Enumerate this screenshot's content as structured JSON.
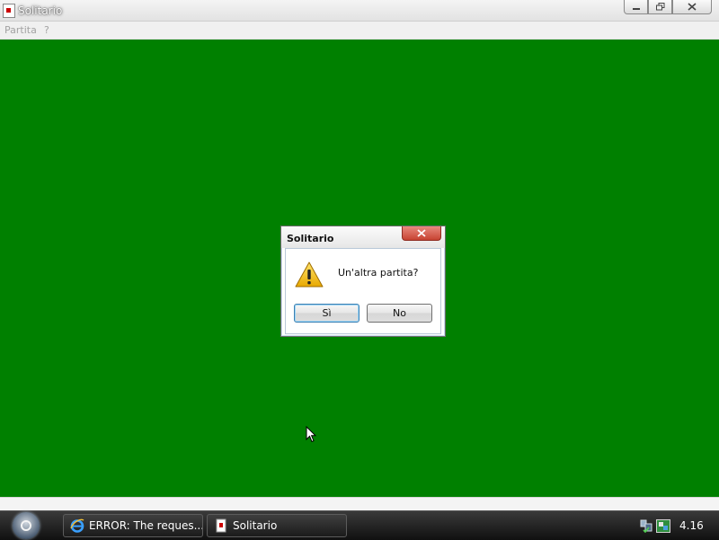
{
  "window": {
    "title": "Solitario",
    "icon": "card-icon",
    "controls": {
      "minimize": "minimize-icon",
      "restore": "restore-icon",
      "close": "close-icon"
    }
  },
  "menu": {
    "items": [
      "Partita",
      "?"
    ]
  },
  "felt_color": "#008000",
  "dialog": {
    "title": "Solitario",
    "icon": "warning-icon",
    "message": "Un'altra partita?",
    "yes_label": "Sì",
    "no_label": "No"
  },
  "taskbar": {
    "tasks": [
      {
        "label": "ERROR: The reques...",
        "icon": "internet-explorer-icon"
      },
      {
        "label": "Solitario",
        "icon": "solitaire-icon"
      }
    ],
    "clock": "4.16"
  }
}
